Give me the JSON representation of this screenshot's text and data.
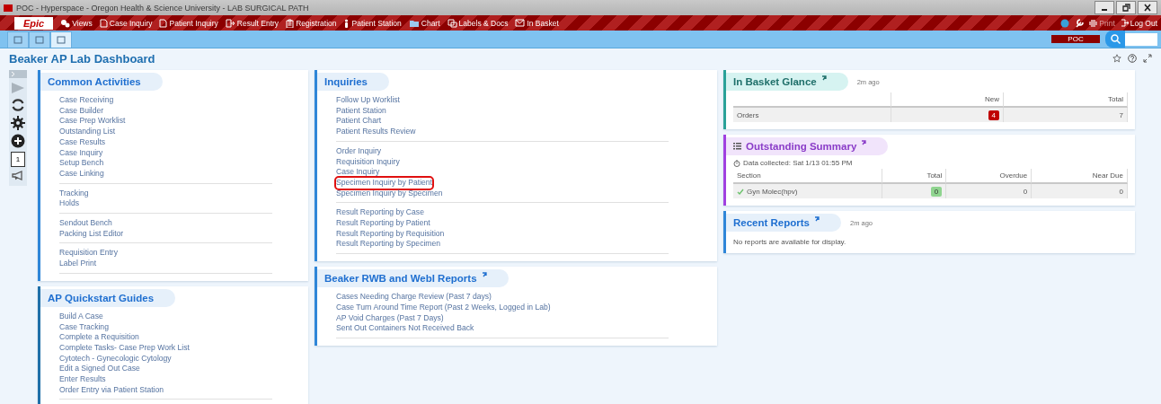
{
  "window": {
    "title": "POC - Hyperspace - Oregon Health & Science University - LAB SURGICAL PATH"
  },
  "toolbar": {
    "logo": "Epic",
    "items": [
      {
        "label": "Views",
        "kind": "menu"
      },
      {
        "label": "Case Inquiry",
        "kind": "doc"
      },
      {
        "label": "Patient Inquiry",
        "kind": "doc"
      },
      {
        "label": "Result Entry",
        "kind": "entry"
      },
      {
        "label": "Registration",
        "kind": "clipboard"
      },
      {
        "label": "Patient Station",
        "kind": "person"
      },
      {
        "label": "Chart",
        "kind": "folder"
      },
      {
        "label": "Labels & Docs",
        "kind": "labels"
      },
      {
        "label": "In Basket",
        "kind": "mail"
      }
    ],
    "right": [
      {
        "label": "Print",
        "disabled": true
      },
      {
        "label": "Log Out",
        "disabled": false
      }
    ]
  },
  "tabbar": {
    "tabs": [
      {
        "selected": false
      },
      {
        "selected": false
      },
      {
        "selected": true
      }
    ],
    "environment": "POC"
  },
  "dashboard": {
    "title": "Beaker AP Lab Dashboard"
  },
  "rail": {
    "monitor_count": "1"
  },
  "columns": [
    [
      {
        "title": "Common Activities",
        "kind": "links",
        "groups": [
          [
            "Case Receiving",
            "Case Builder",
            "Case Prep Worklist",
            "Outstanding List",
            "Case Results",
            "Case Inquiry",
            "Setup Bench",
            "Case Linking"
          ],
          [
            "Tracking",
            "Holds"
          ],
          [
            "Sendout Bench",
            "Packing List Editor"
          ],
          [
            "Requisition Entry",
            "Label Print"
          ]
        ]
      },
      {
        "title": "AP Quickstart Guides",
        "kind": "links",
        "groups": [
          [
            "Build A Case",
            "Case Tracking",
            "Complete a Requisition",
            "Complete Tasks- Case Prep Work List",
            "Cytotech - Gynecologic Cytology",
            "Edit a Signed Out Case",
            "Enter Results",
            "Order Entry via Patient Station"
          ]
        ]
      }
    ],
    [
      {
        "title": "Inquiries",
        "kind": "links",
        "groups": [
          [
            "Follow Up Worklist",
            "Patient Station",
            "Patient Chart",
            "Patient Results Review"
          ],
          [
            "Order Inquiry",
            "Requisition Inquiry",
            "Case Inquiry",
            {
              "label": "Specimen Inquiry by Patient",
              "highlighted": true
            },
            "Specimen Inquiry by Specimen"
          ],
          [
            "Result Reporting by Case",
            "Result Reporting by Patient",
            "Result Reporting by Requisition",
            "Result Reporting by Specimen"
          ]
        ]
      },
      {
        "title": "Beaker RWB and WebI Reports",
        "kind": "links",
        "link": true,
        "groups": [
          [
            "Cases Needing Charge Review (Past 7 days)",
            "Case Turn Around Time Report (Past 2 Weeks, Logged in Lab)",
            "AP Void Charges (Past 7 Days)",
            "Sent Out Containers Not Received Back"
          ]
        ]
      }
    ],
    [
      {
        "title": "In Basket Glance",
        "kind": "table",
        "link": true,
        "age": "2m ago",
        "columns": [
          "",
          "New",
          "Total"
        ],
        "rows": [
          [
            {
              "text": "Orders"
            },
            {
              "text": "4",
              "color": "#c00000"
            },
            {
              "text": "7"
            }
          ]
        ]
      },
      {
        "title": "Outstanding Summary",
        "kind": "table",
        "link": true,
        "menu": true,
        "collected": "Data collected: Sat 1/13 01:55 PM",
        "columns": [
          "Section",
          "Total",
          "Overdue",
          "Near Due"
        ],
        "rows": [
          [
            {
              "text": "Gyn Molec(hpv)",
              "checked": true
            },
            {
              "text": "0",
              "color": "#8fd48f"
            },
            {
              "text": "0"
            },
            {
              "text": "0"
            }
          ]
        ]
      },
      {
        "title": "Recent Reports",
        "kind": "message",
        "link": true,
        "age": "2m ago",
        "message": "No reports are available for display."
      }
    ]
  ]
}
